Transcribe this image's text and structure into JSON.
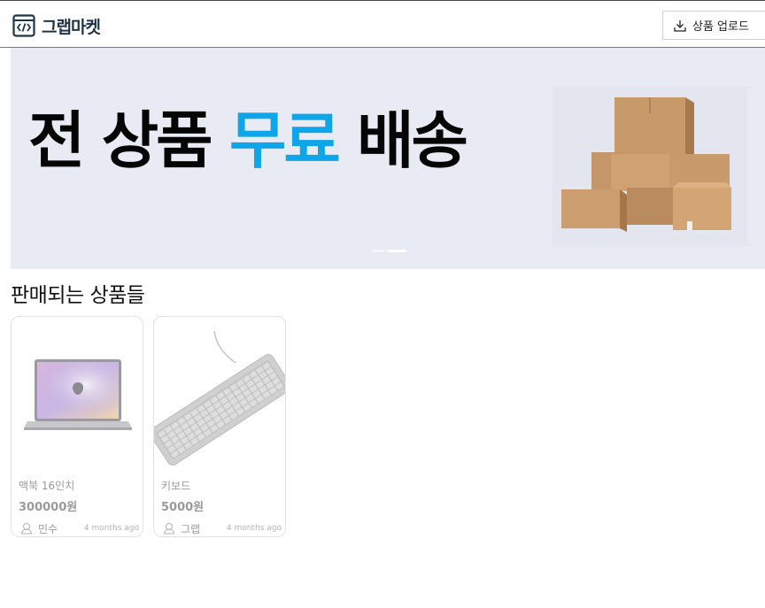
{
  "header": {
    "logo_text": "그랩마켓",
    "upload_label": "상품 업로드"
  },
  "banner": {
    "text_part1": "전 상품 ",
    "text_accent": "무료",
    "text_part2": " 배송",
    "accent_color": "#0ea5e9",
    "background": "#e8ebf3",
    "slide_count": 2,
    "active_slide": 2
  },
  "products_section": {
    "title": "판매되는 상품들"
  },
  "products": [
    {
      "name": "맥북 16인치",
      "price": "300000원",
      "seller": "민수",
      "time": "4 months ago",
      "image": "laptop-image"
    },
    {
      "name": "키보드",
      "price": "5000원",
      "seller": "그랩",
      "time": "4 months ago",
      "image": "keyboard-image"
    }
  ]
}
